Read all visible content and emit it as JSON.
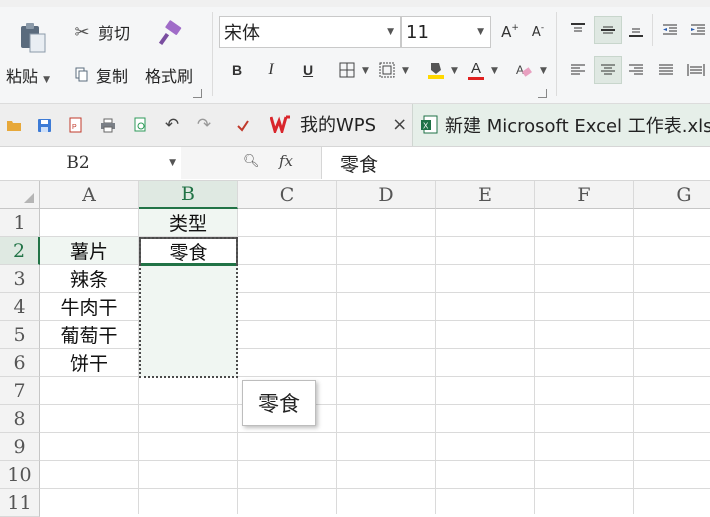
{
  "ribbon": {
    "paste_label": "粘贴",
    "cut_label": "剪切",
    "copy_label": "复制",
    "format_painter_label": "格式刷",
    "font_name": "宋体",
    "font_size": "11",
    "grow_font": "A",
    "shrink_font": "A",
    "bold": "B",
    "italic": "I",
    "underline": "U",
    "font_color_letter": "A"
  },
  "tabs": {
    "my_wps": "我的WPS",
    "excel_file": "新建 Microsoft Excel 工作表.xlsx"
  },
  "formula_bar": {
    "cell_ref": "B2",
    "fx": "fx",
    "content": "零食"
  },
  "grid": {
    "columns": [
      "A",
      "B",
      "C",
      "D",
      "E",
      "F",
      "G"
    ],
    "rows": [
      "1",
      "2",
      "3",
      "4",
      "5",
      "6",
      "7",
      "8",
      "9",
      "10",
      "11"
    ],
    "a_values": [
      "",
      "薯片",
      "辣条",
      "牛肉干",
      "葡萄干",
      "饼干"
    ],
    "b_values": [
      "类型",
      "零食"
    ]
  },
  "paste_tooltip": "零食",
  "colors": {
    "active_green": "#217346",
    "wps_red": "#d9262c",
    "excel_green": "#1e7145",
    "selection_fill": "#e1f0e6"
  }
}
